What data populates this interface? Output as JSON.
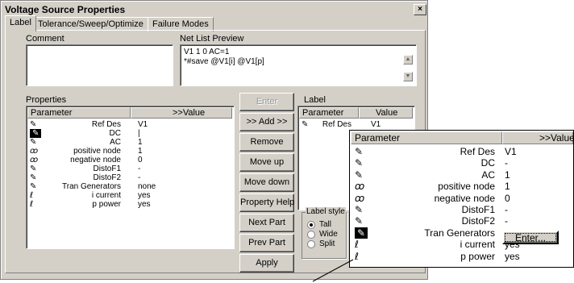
{
  "window": {
    "title": "Voltage Source Properties",
    "close_glyph": "×"
  },
  "tabs": [
    {
      "label": "Label",
      "active": true
    },
    {
      "label": "Tolerance/Sweep/Optimize",
      "active": false
    },
    {
      "label": "Failure Modes",
      "active": false
    }
  ],
  "comment": {
    "label": "Comment",
    "value": ""
  },
  "netlist": {
    "label": "Net List Preview",
    "lines": [
      "V1 1 0 AC=1",
      "*#save  @V1[i] @V1[p]"
    ]
  },
  "properties": {
    "label": "Properties",
    "col_parameter": "Parameter",
    "col_value": ">>Value",
    "rows": [
      {
        "icon": "pencil-icon",
        "name": "Ref Des",
        "value": "V1"
      },
      {
        "icon": "pencil-selected-icon",
        "name": "DC",
        "value": "|"
      },
      {
        "icon": "pencil-icon",
        "name": "AC",
        "value": "1"
      },
      {
        "icon": "glasses-icon",
        "name": "positive node",
        "value": "1"
      },
      {
        "icon": "glasses-icon",
        "name": "negative node",
        "value": "0"
      },
      {
        "icon": "pencil-icon",
        "name": "DistoF1",
        "value": "-"
      },
      {
        "icon": "pencil-icon",
        "name": "DistoF2",
        "value": "-"
      },
      {
        "icon": "pencil-icon",
        "name": "Tran Generators",
        "value": "none"
      },
      {
        "icon": "script-icon",
        "name": "i current",
        "value": "yes"
      },
      {
        "icon": "script-icon",
        "name": "p power",
        "value": "yes"
      }
    ]
  },
  "buttons": {
    "enter": "Enter",
    "add": ">> Add >>",
    "remove": "Remove",
    "move_up": "Move up",
    "move_down": "Move down",
    "property_help": "Property Help",
    "next_part": "Next Part",
    "prev_part": "Prev Part",
    "apply": "Apply"
  },
  "label_panel": {
    "label": "Label",
    "col_parameter": "Parameter",
    "col_value": "Value",
    "rows": [
      {
        "icon": "pencil-icon",
        "name": "Ref Des",
        "value": "V1"
      }
    ]
  },
  "label_style": {
    "label": "Label style",
    "options": [
      {
        "label": "Tall",
        "selected": true
      },
      {
        "label": "Wide",
        "selected": false
      },
      {
        "label": "Split",
        "selected": false
      }
    ]
  },
  "zoom": {
    "col_parameter": "Parameter",
    "col_value": ">>Value",
    "rows": [
      {
        "icon": "pencil-icon",
        "name": "Ref Des",
        "value": "V1"
      },
      {
        "icon": "pencil-icon",
        "name": "DC",
        "value": "-"
      },
      {
        "icon": "pencil-icon",
        "name": "AC",
        "value": "1"
      },
      {
        "icon": "glasses-icon",
        "name": "positive node",
        "value": "1"
      },
      {
        "icon": "glasses-icon",
        "name": "negative node",
        "value": "0"
      },
      {
        "icon": "pencil-icon",
        "name": "DistoF1",
        "value": "-"
      },
      {
        "icon": "pencil-icon",
        "name": "DistoF2",
        "value": "-"
      },
      {
        "icon": "pencil-selected-icon",
        "name": "Tran Generators",
        "value": ""
      },
      {
        "icon": "script-icon",
        "name": "i current",
        "value": "yes"
      },
      {
        "icon": "script-icon",
        "name": "p power",
        "value": "yes"
      }
    ],
    "enter_button": "Enter..."
  }
}
